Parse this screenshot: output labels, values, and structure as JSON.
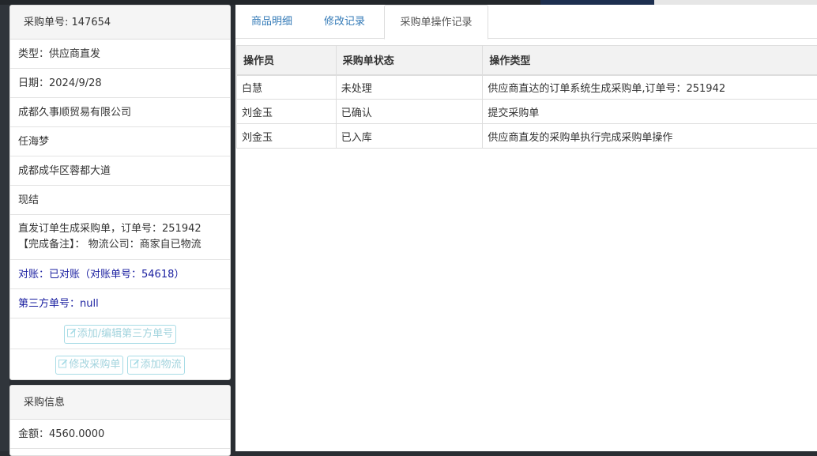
{
  "order_panel": {
    "heading": "采购单号: 147654",
    "items": [
      "类型：供应商直发",
      "日期：2024/9/28",
      "成都久事顺贸易有限公司",
      "任海梦",
      "成都成华区蓉都大道",
      "现结"
    ],
    "remark_line1": "直发订单生成采购单，订单号：251942",
    "remark_line2": "【完成备注】： 物流公司：商家自已物流",
    "reconcile": "对账：已对账（对账单号：54618）",
    "third_party": "第三方单号：null",
    "btn_add_edit_third": "添加/编辑第三方单号",
    "btn_modify_order": "修改采购单",
    "btn_add_logistics": "添加物流"
  },
  "info_panel": {
    "heading": "采购信息",
    "amount": "金额：4560.0000"
  },
  "tabs": [
    {
      "label": "商品明细",
      "active": false
    },
    {
      "label": "修改记录",
      "active": false
    },
    {
      "label": "采购单操作记录",
      "active": true
    }
  ],
  "log_table": {
    "headers": [
      "操作员",
      "采购单状态",
      "操作类型"
    ],
    "rows": [
      [
        "白慧",
        "未处理",
        "供应商直达的订单系统生成采购单,订单号：251942"
      ],
      [
        "刘金玉",
        "已确认",
        "提交采购单"
      ],
      [
        "刘金玉",
        "已入库",
        "供应商直发的采购单执行完成采购单操作"
      ]
    ]
  },
  "icons": {
    "edit": "edit-icon"
  },
  "colors": {
    "link_blue": "#337ab7",
    "status_blue": "#1a1fa0",
    "disabled_btn": "#a8dce6"
  }
}
